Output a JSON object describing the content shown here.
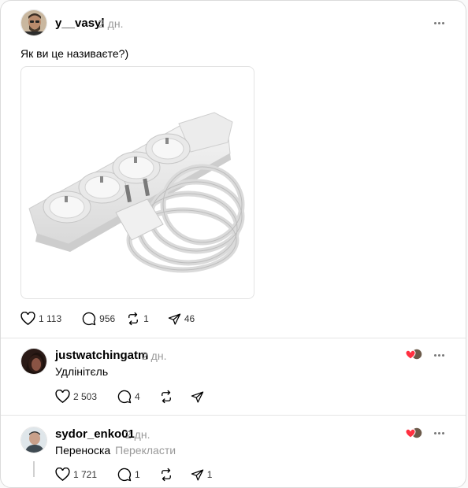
{
  "post": {
    "username": "y__vasyl",
    "time": "2 дн.",
    "text": "Як ви це називаєте?)",
    "image_alt": "extension-cord-power-strip",
    "likes": "1 113",
    "comments": "956",
    "reposts": "1",
    "shares": "46"
  },
  "replies": [
    {
      "username": "justwatchingatm",
      "time": "2 дн.",
      "text": "Удлінітєль",
      "likes": "2 503",
      "comments": "4"
    },
    {
      "username": "sydor_enko01",
      "time": "2 дн.",
      "text": "Переноска",
      "translate_label": "Перекласти",
      "likes": "1 721",
      "comments": "1",
      "shares": "1"
    }
  ],
  "colors": {
    "heart_red": "#ff3040",
    "muted_text": "#999999",
    "border": "#e5e5e5"
  }
}
